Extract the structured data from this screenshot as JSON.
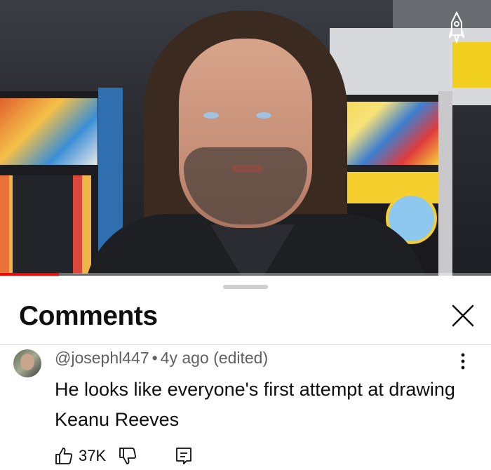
{
  "comments_panel": {
    "title": "Comments",
    "close_icon": "close-icon"
  },
  "video": {
    "progress_fraction": 0.12,
    "channel_logo_icon": "rocket-icon"
  },
  "comment": {
    "author": "@josephl447",
    "separator": "•",
    "timestamp": "4y ago (edited)",
    "text": "He looks like everyone's first attempt at drawing Keanu Reeves",
    "like_count": "37K",
    "icons": [
      "thumbs-up-icon",
      "thumbs-down-icon",
      "reply-icon",
      "more-vert-icon"
    ]
  },
  "colors": {
    "progress": "#ff0000",
    "text_primary": "#0f0f0f",
    "text_secondary": "#606060"
  }
}
